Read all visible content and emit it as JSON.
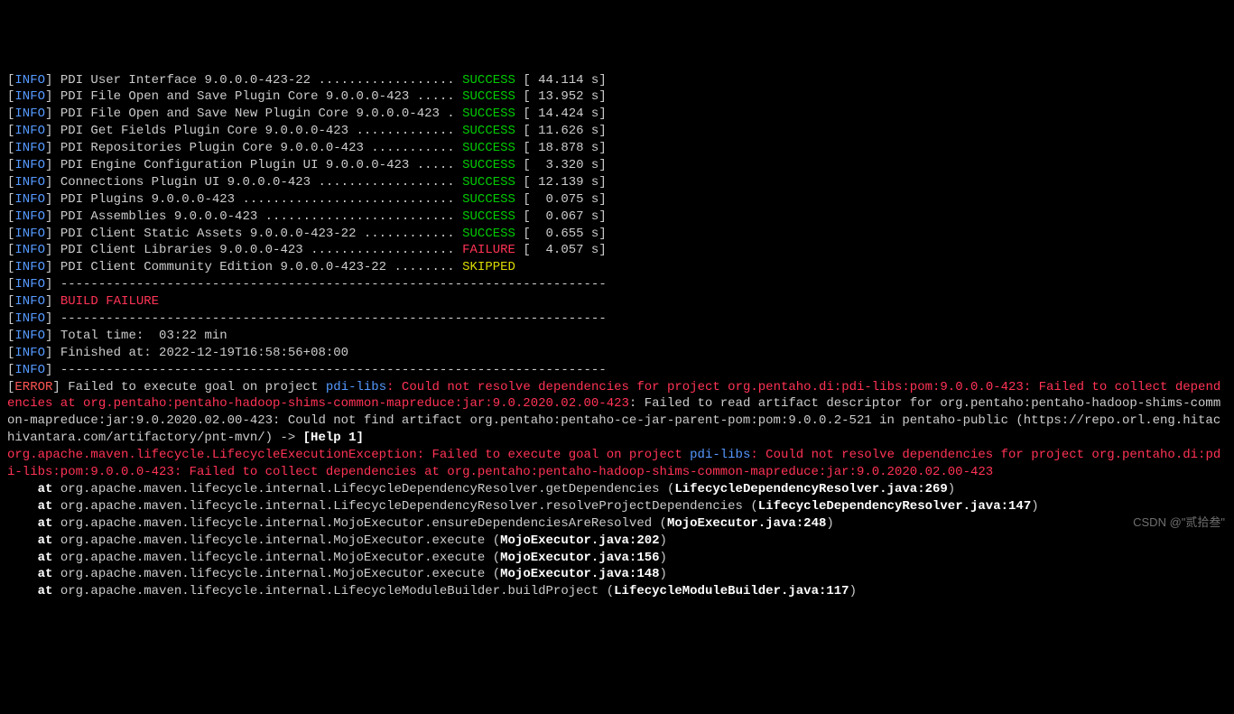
{
  "build_lines": [
    {
      "level": "INFO",
      "module": "PDI User Interface 9.0.0.0-423-22",
      "dots": "..................",
      "status": "SUCCESS",
      "time": "[ 44.114 s]"
    },
    {
      "level": "INFO",
      "module": "PDI File Open and Save Plugin Core 9.0.0.0-423",
      "dots": ".....",
      "status": "SUCCESS",
      "time": "[ 13.952 s]"
    },
    {
      "level": "INFO",
      "module": "PDI File Open and Save New Plugin Core 9.0.0.0-423",
      "dots": ".",
      "status": "SUCCESS",
      "time": "[ 14.424 s]"
    },
    {
      "level": "INFO",
      "module": "PDI Get Fields Plugin Core 9.0.0.0-423",
      "dots": ".............",
      "status": "SUCCESS",
      "time": "[ 11.626 s]"
    },
    {
      "level": "INFO",
      "module": "PDI Repositories Plugin Core 9.0.0.0-423",
      "dots": "...........",
      "status": "SUCCESS",
      "time": "[ 18.878 s]"
    },
    {
      "level": "INFO",
      "module": "PDI Engine Configuration Plugin UI 9.0.0.0-423",
      "dots": ".....",
      "status": "SUCCESS",
      "time": "[  3.320 s]"
    },
    {
      "level": "INFO",
      "module": "Connections Plugin UI 9.0.0.0-423",
      "dots": "..................",
      "status": "SUCCESS",
      "time": "[ 12.139 s]"
    },
    {
      "level": "INFO",
      "module": "PDI Plugins 9.0.0.0-423",
      "dots": "............................",
      "status": "SUCCESS",
      "time": "[  0.075 s]"
    },
    {
      "level": "INFO",
      "module": "PDI Assemblies 9.0.0.0-423",
      "dots": ".........................",
      "status": "SUCCESS",
      "time": "[  0.067 s]"
    },
    {
      "level": "INFO",
      "module": "PDI Client Static Assets 9.0.0.0-423-22",
      "dots": "............",
      "status": "SUCCESS",
      "time": "[  0.655 s]"
    },
    {
      "level": "INFO",
      "module": "PDI Client Libraries 9.0.0.0-423",
      "dots": "...................",
      "status": "FAILURE",
      "time": "[  4.057 s]"
    },
    {
      "level": "INFO",
      "module": "PDI Client Community Edition 9.0.0.0-423-22",
      "dots": "........",
      "status": "SKIPPED",
      "time": ""
    }
  ],
  "separator": "------------------------------------------------------------------------",
  "build_failure": "BUILD FAILURE",
  "total_time": "Total time:  03:22 min",
  "finished_at": "Finished at: 2022-12-19T16:58:56+08:00",
  "error_prefix": " Failed to execute goal on project ",
  "error_project": "pdi-libs",
  "error_msg1": ": Could not resolve dependencies for project org.pentaho.di:pdi-libs:pom:9.0.0.0-423: Failed to collect dependencies at org.pentaho:pentaho-hadoop-shims-common-mapreduce:jar:9.0.2020.02.00-423",
  "error_msg2": ": Failed to read artifact descriptor for org.pentaho:pentaho-hadoop-shims-common-mapreduce:jar:9.0.2020.02.00-423: Could not find artifact org.pentaho:pentaho-ce-jar-parent-pom:pom:9.0.0.2-521 in pentaho-public (https://repo.orl.eng.hitachivantara.com/artifactory/pnt-mvn/) -> ",
  "help_link": "[Help 1]",
  "exception_class": "org.apache.maven.lifecycle.LifecycleExecutionException",
  "exception_msg1": ": Failed to execute goal on project ",
  "exception_project": "pdi-libs",
  "exception_msg2": ": Could not resolve dependencies for project org.pentaho.di:pdi-libs:pom:9.0.0.0-423: Failed to collect dependencies at org.pentaho:pentaho-hadoop-shims-common-mapreduce:jar:9.0.2020.02.00-423",
  "stack": [
    {
      "method": "org.apache.maven.lifecycle.internal.LifecycleDependencyResolver.getDependencies",
      "file": "LifecycleDependencyResolver.java:269"
    },
    {
      "method": "org.apache.maven.lifecycle.internal.LifecycleDependencyResolver.resolveProjectDependencies",
      "file": "LifecycleDependencyResolver.java:147"
    },
    {
      "method": "org.apache.maven.lifecycle.internal.MojoExecutor.ensureDependenciesAreResolved",
      "file": "MojoExecutor.java:248"
    },
    {
      "method": "org.apache.maven.lifecycle.internal.MojoExecutor.execute",
      "file": "MojoExecutor.java:202"
    },
    {
      "method": "org.apache.maven.lifecycle.internal.MojoExecutor.execute",
      "file": "MojoExecutor.java:156"
    },
    {
      "method": "org.apache.maven.lifecycle.internal.MojoExecutor.execute",
      "file": "MojoExecutor.java:148"
    },
    {
      "method": "org.apache.maven.lifecycle.internal.LifecycleModuleBuilder.buildProject",
      "file": "LifecycleModuleBuilder.java:117"
    }
  ],
  "watermark": "CSDN @\"贰拾叁\""
}
